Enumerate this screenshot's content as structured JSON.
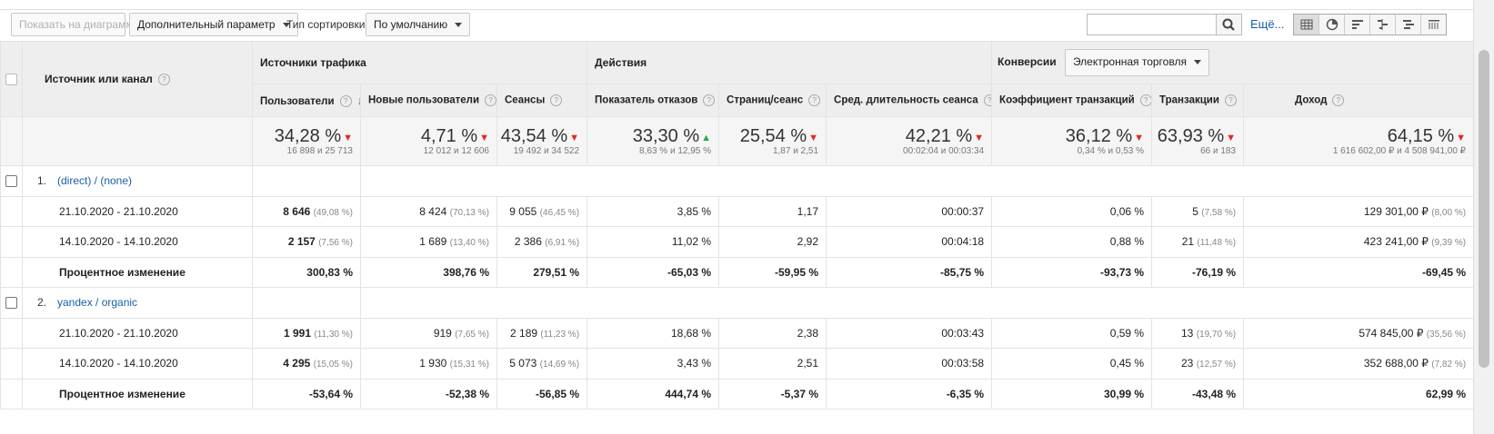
{
  "toolbar": {
    "plot_button": "Показать на диаграмме",
    "secondary_dimension": "Дополнительный параметр",
    "sort_label": "Тип сортировки:",
    "sort_value": "По умолчанию",
    "search_placeholder": "",
    "more_link": "Ещё...",
    "view_icons": [
      "table-view-icon",
      "pie-view-icon",
      "bar-view-icon",
      "comparison-view-icon",
      "term-cloud-view-icon",
      "pivot-view-icon"
    ]
  },
  "table": {
    "dimension_header": "Источник или канал",
    "groups": {
      "acquisition": "Источники трафика",
      "behavior": "Действия",
      "conversions": "Конверсии",
      "conversions_select": "Электронная торговля"
    },
    "columns": [
      "Пользователи",
      "Новые пользователи",
      "Сеансы",
      "Показатель отказов",
      "Страниц/сеанс",
      "Сред. длительность сеанса",
      "Коэффициент транзакций",
      "Транзакции",
      "Доход"
    ],
    "summary": [
      {
        "value": "34,28 %",
        "trend": "down",
        "detail": "16 898 и 25 713"
      },
      {
        "value": "4,71 %",
        "trend": "down",
        "detail": "12 012 и 12 606"
      },
      {
        "value": "43,54 %",
        "trend": "down",
        "detail": "19 492 и 34 522"
      },
      {
        "value": "33,30 %",
        "trend": "up",
        "detail": "8,63 % и 12,95 %"
      },
      {
        "value": "25,54 %",
        "trend": "down",
        "detail": "1,87 и 2,51"
      },
      {
        "value": "42,21 %",
        "trend": "down",
        "detail": "00:02:04 и 00:03:34"
      },
      {
        "value": "36,12 %",
        "trend": "down",
        "detail": "0,34 % и 0,53 %"
      },
      {
        "value": "63,93 %",
        "trend": "down",
        "detail": "66 и 183"
      },
      {
        "value": "64,15 %",
        "trend": "down",
        "detail": "1 616 602,00 ₽ и 4 508 941,00 ₽"
      }
    ],
    "sources": [
      {
        "index": "1.",
        "name": "(direct) / (none)",
        "rows": [
          {
            "label": "21.10.2020 - 21.10.2020",
            "bold": false,
            "cells": [
              {
                "v": "8 646",
                "p": "(49,08 %)",
                "b": true
              },
              {
                "v": "8 424",
                "p": "(70,13 %)",
                "b": false
              },
              {
                "v": "9 055",
                "p": "(46,45 %)",
                "b": false
              },
              {
                "v": "3,85 %",
                "p": "",
                "b": false
              },
              {
                "v": "1,17",
                "p": "",
                "b": false
              },
              {
                "v": "00:00:37",
                "p": "",
                "b": false
              },
              {
                "v": "0,06 %",
                "p": "",
                "b": false
              },
              {
                "v": "5",
                "p": "(7,58 %)",
                "b": false
              },
              {
                "v": "129 301,00 ₽",
                "p": "(8,00 %)",
                "b": false
              }
            ]
          },
          {
            "label": "14.10.2020 - 14.10.2020",
            "bold": false,
            "cells": [
              {
                "v": "2 157",
                "p": "(7,56 %)",
                "b": true
              },
              {
                "v": "1 689",
                "p": "(13,40 %)",
                "b": false
              },
              {
                "v": "2 386",
                "p": "(6,91 %)",
                "b": false
              },
              {
                "v": "11,02 %",
                "p": "",
                "b": false
              },
              {
                "v": "2,92",
                "p": "",
                "b": false
              },
              {
                "v": "00:04:18",
                "p": "",
                "b": false
              },
              {
                "v": "0,88 %",
                "p": "",
                "b": false
              },
              {
                "v": "21",
                "p": "(11,48 %)",
                "b": false
              },
              {
                "v": "423 241,00 ₽",
                "p": "(9,39 %)",
                "b": false
              }
            ]
          },
          {
            "label": "Процентное изменение",
            "bold": true,
            "cells": [
              {
                "v": "300,83 %",
                "p": "",
                "b": true
              },
              {
                "v": "398,76 %",
                "p": "",
                "b": true
              },
              {
                "v": "279,51 %",
                "p": "",
                "b": true
              },
              {
                "v": "-65,03 %",
                "p": "",
                "b": true
              },
              {
                "v": "-59,95 %",
                "p": "",
                "b": true
              },
              {
                "v": "-85,75 %",
                "p": "",
                "b": true
              },
              {
                "v": "-93,73 %",
                "p": "",
                "b": true
              },
              {
                "v": "-76,19 %",
                "p": "",
                "b": true
              },
              {
                "v": "-69,45 %",
                "p": "",
                "b": true
              }
            ]
          }
        ]
      },
      {
        "index": "2.",
        "name": "yandex / organic",
        "rows": [
          {
            "label": "21.10.2020 - 21.10.2020",
            "bold": false,
            "cells": [
              {
                "v": "1 991",
                "p": "(11,30 %)",
                "b": true
              },
              {
                "v": "919",
                "p": "(7,65 %)",
                "b": false
              },
              {
                "v": "2 189",
                "p": "(11,23 %)",
                "b": false
              },
              {
                "v": "18,68 %",
                "p": "",
                "b": false
              },
              {
                "v": "2,38",
                "p": "",
                "b": false
              },
              {
                "v": "00:03:43",
                "p": "",
                "b": false
              },
              {
                "v": "0,59 %",
                "p": "",
                "b": false
              },
              {
                "v": "13",
                "p": "(19,70 %)",
                "b": false
              },
              {
                "v": "574 845,00 ₽",
                "p": "(35,56 %)",
                "b": false
              }
            ]
          },
          {
            "label": "14.10.2020 - 14.10.2020",
            "bold": false,
            "cells": [
              {
                "v": "4 295",
                "p": "(15,05 %)",
                "b": true
              },
              {
                "v": "1 930",
                "p": "(15,31 %)",
                "b": false
              },
              {
                "v": "5 073",
                "p": "(14,69 %)",
                "b": false
              },
              {
                "v": "3,43 %",
                "p": "",
                "b": false
              },
              {
                "v": "2,51",
                "p": "",
                "b": false
              },
              {
                "v": "00:03:58",
                "p": "",
                "b": false
              },
              {
                "v": "0,45 %",
                "p": "",
                "b": false
              },
              {
                "v": "23",
                "p": "(12,57 %)",
                "b": false
              },
              {
                "v": "352 688,00 ₽",
                "p": "(7,82 %)",
                "b": false
              }
            ]
          },
          {
            "label": "Процентное изменение",
            "bold": true,
            "cells": [
              {
                "v": "-53,64 %",
                "p": "",
                "b": true
              },
              {
                "v": "-52,38 %",
                "p": "",
                "b": true
              },
              {
                "v": "-56,85 %",
                "p": "",
                "b": true
              },
              {
                "v": "444,74 %",
                "p": "",
                "b": true
              },
              {
                "v": "-5,37 %",
                "p": "",
                "b": true
              },
              {
                "v": "-6,35 %",
                "p": "",
                "b": true
              },
              {
                "v": "30,99 %",
                "p": "",
                "b": true
              },
              {
                "v": "-43,48 %",
                "p": "",
                "b": true
              },
              {
                "v": "62,99 %",
                "p": "",
                "b": true
              }
            ]
          }
        ]
      }
    ]
  },
  "colors": {
    "link": "#1a5fa8",
    "trend_down": "#e8261e",
    "trend_up": "#2aa84a",
    "header_bg": "#eeeeee"
  }
}
